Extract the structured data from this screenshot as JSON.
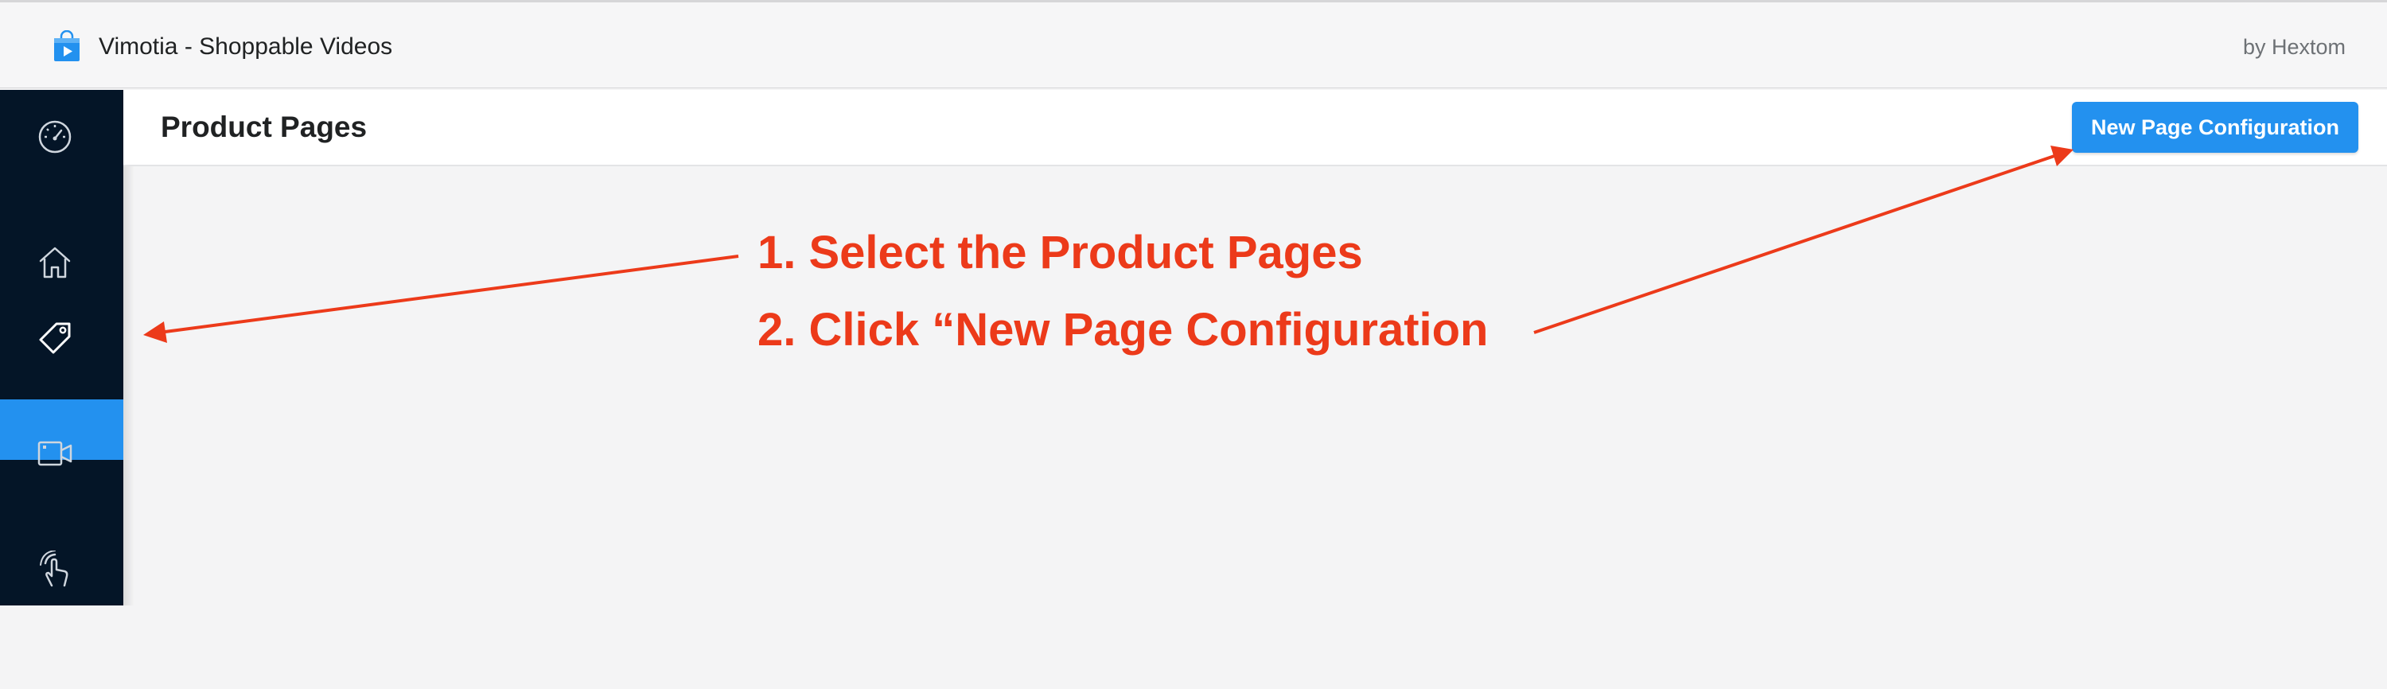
{
  "topbar": {
    "app_title": "Vimotia - Shoppable Videos",
    "vendor": "by Hextom",
    "app_icon": "shopping-bag-play-icon"
  },
  "sidebar": {
    "items": [
      {
        "icon": "dashboard-gauge-icon",
        "active": false
      },
      {
        "icon": "home-icon",
        "active": false
      },
      {
        "icon": "tag-icon",
        "active": true
      },
      {
        "icon": "video-camera-icon",
        "active": false
      },
      {
        "icon": "tap-hand-icon",
        "active": false
      }
    ]
  },
  "header": {
    "title": "Product Pages",
    "new_config_label": "New Page Configuration"
  },
  "annotations": {
    "step1": "1. Select the Product Pages",
    "step2": "2. Click “New Page Configuration"
  },
  "colors": {
    "sidebar_bg": "#041527",
    "accent": "#2391ef",
    "annotation": "#ec3a1a"
  }
}
